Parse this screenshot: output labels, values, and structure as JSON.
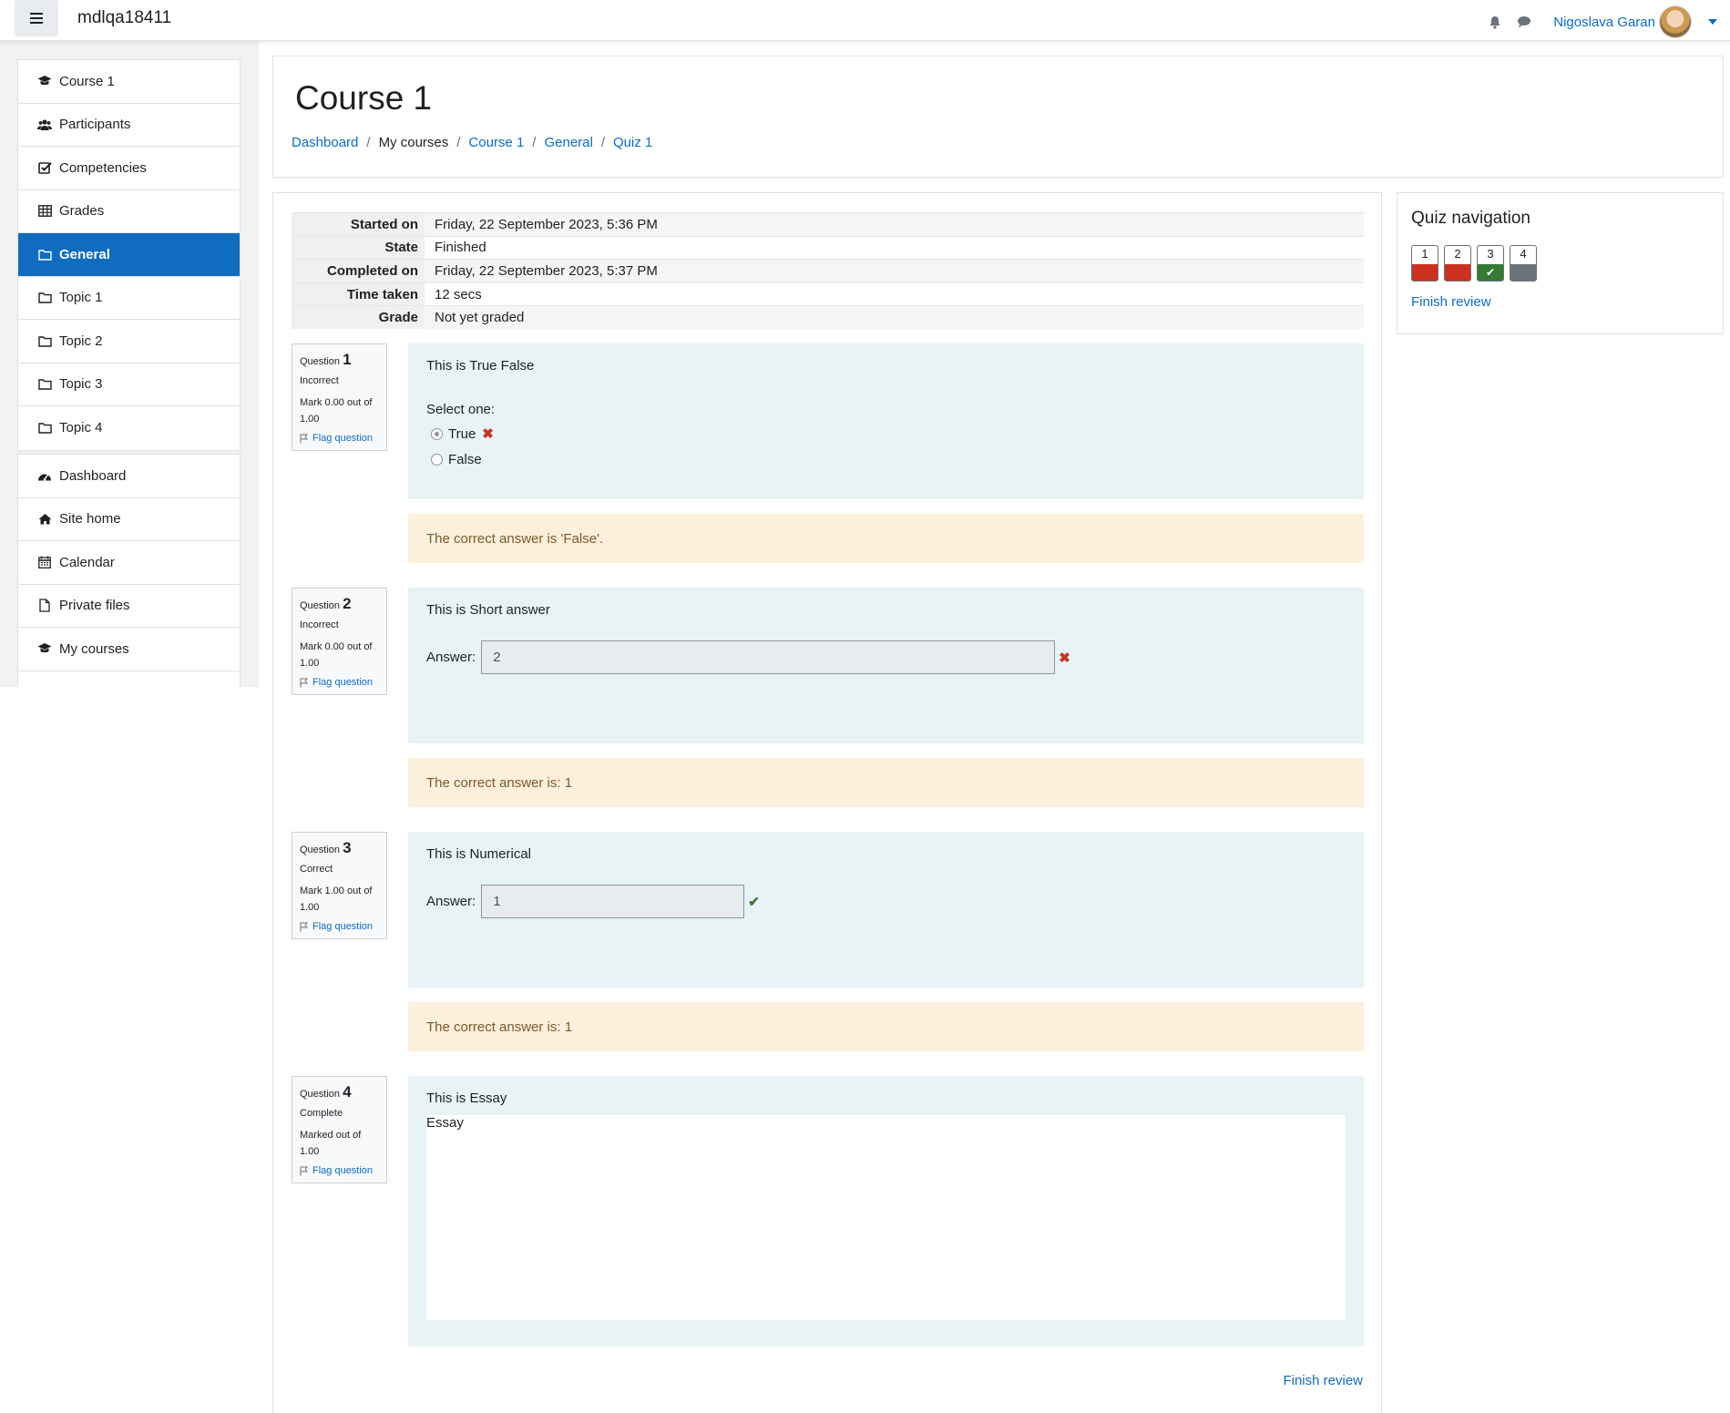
{
  "navbar": {
    "site_name": "mdlqa18411",
    "user_name": "Nigoslava Garan"
  },
  "drawer": {
    "course_items": [
      {
        "label": "Course 1",
        "icon": "graduation-cap-icon"
      },
      {
        "label": "Participants",
        "icon": "users-icon"
      },
      {
        "label": "Competencies",
        "icon": "checkbox-icon"
      },
      {
        "label": "Grades",
        "icon": "table-icon"
      },
      {
        "label": "General",
        "icon": "folder-icon",
        "active": true
      },
      {
        "label": "Topic 1",
        "icon": "folder-icon"
      },
      {
        "label": "Topic 2",
        "icon": "folder-icon"
      },
      {
        "label": "Topic 3",
        "icon": "folder-icon"
      },
      {
        "label": "Topic 4",
        "icon": "folder-icon"
      }
    ],
    "site_items": [
      {
        "label": "Dashboard",
        "icon": "dashboard-icon"
      },
      {
        "label": "Site home",
        "icon": "home-icon"
      },
      {
        "label": "Calendar",
        "icon": "calendar-icon"
      },
      {
        "label": "Private files",
        "icon": "file-icon"
      },
      {
        "label": "My courses",
        "icon": "graduation-cap-icon"
      }
    ]
  },
  "header": {
    "title": "Course 1",
    "breadcrumb": {
      "dashboard": "Dashboard",
      "my_courses": "My courses",
      "course": "Course 1",
      "section": "General",
      "quiz": "Quiz 1"
    }
  },
  "summary": {
    "rows": [
      {
        "label": "Started on",
        "value": "Friday, 22 September 2023, 5:36 PM"
      },
      {
        "label": "State",
        "value": "Finished"
      },
      {
        "label": "Completed on",
        "value": "Friday, 22 September 2023, 5:37 PM"
      },
      {
        "label": "Time taken",
        "value": "12 secs"
      },
      {
        "label": "Grade",
        "value": "Not yet graded"
      }
    ]
  },
  "questions": [
    {
      "prefix": "Question",
      "number": "1",
      "state": "Incorrect",
      "grade": "Mark 0.00 out of 1.00",
      "flag": "Flag question",
      "text": "This is True False",
      "prompt": "Select one:",
      "options": [
        "True",
        "False"
      ],
      "selected": "True",
      "feedback": "The correct answer is 'False'."
    },
    {
      "prefix": "Question",
      "number": "2",
      "state": "Incorrect",
      "grade": "Mark 0.00 out of 1.00",
      "flag": "Flag question",
      "text": "This is Short answer",
      "answer_label": "Answer:",
      "answer": "2",
      "feedback": "The correct answer is: 1"
    },
    {
      "prefix": "Question",
      "number": "3",
      "state": "Correct",
      "grade": "Mark 1.00 out of 1.00",
      "flag": "Flag question",
      "text": "This is Numerical",
      "answer_label": "Answer:",
      "answer": "1",
      "feedback": "The correct answer is: 1"
    },
    {
      "prefix": "Question",
      "number": "4",
      "state": "Complete",
      "grade": "Marked out of 1.00",
      "flag": "Flag question",
      "text": "This is Essay",
      "answer": "Essay"
    }
  ],
  "quiz_navigation": {
    "title": "Quiz navigation",
    "buttons": [
      {
        "number": "1",
        "status": "incorrect",
        "color": "#ca3120"
      },
      {
        "number": "2",
        "status": "incorrect",
        "color": "#ca3120"
      },
      {
        "number": "3",
        "status": "correct",
        "color": "#357a32"
      },
      {
        "number": "4",
        "status": "complete",
        "color": "#6a737b"
      }
    ],
    "finish_label": "Finish review"
  },
  "finish_review": "Finish review",
  "colors": {
    "brand": "#0f6cbf",
    "incorrect": "#ca3120",
    "correct": "#357a32",
    "formulation_bg": "#e7f3f5",
    "feedback_bg": "#fcefdc"
  }
}
